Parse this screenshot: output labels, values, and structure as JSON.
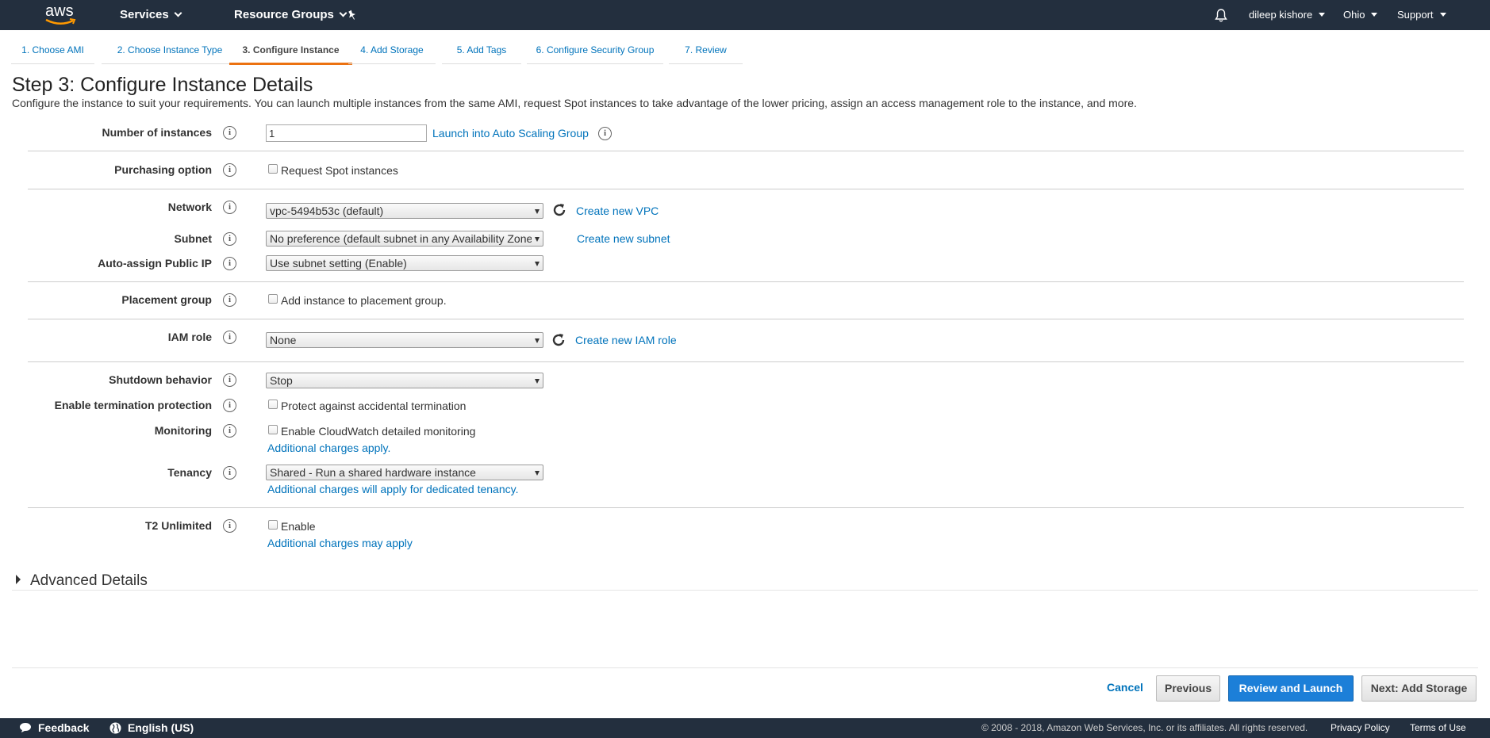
{
  "topnav": {
    "logo_text": "aws",
    "services": "Services",
    "resource_groups": "Resource Groups",
    "user": "dileep kishore",
    "region": "Ohio",
    "support": "Support"
  },
  "wizard_tabs": [
    "1. Choose AMI",
    "2. Choose Instance Type",
    "3. Configure Instance",
    "4. Add Storage",
    "5. Add Tags",
    "6. Configure Security Group",
    "7. Review"
  ],
  "active_tab_index": 2,
  "page": {
    "title": "Step 3: Configure Instance Details",
    "subtitle": "Configure the instance to suit your requirements. You can launch multiple instances from the same AMI, request Spot instances to take advantage of the lower pricing, assign an access management role to the instance, and more."
  },
  "form": {
    "instances": {
      "label": "Number of instances",
      "value": "1",
      "link": "Launch into Auto Scaling Group"
    },
    "purchasing": {
      "label": "Purchasing option",
      "checkbox": "Request Spot instances"
    },
    "network": {
      "label": "Network",
      "value": "vpc-5494b53c (default)",
      "link": "Create new VPC"
    },
    "subnet": {
      "label": "Subnet",
      "value": "No preference (default subnet in any Availability Zone)",
      "link": "Create new subnet"
    },
    "public_ip": {
      "label": "Auto-assign Public IP",
      "value": "Use subnet setting (Enable)"
    },
    "placement": {
      "label": "Placement group",
      "checkbox": "Add instance to placement group."
    },
    "iam": {
      "label": "IAM role",
      "value": "None",
      "link": "Create new IAM role"
    },
    "shutdown": {
      "label": "Shutdown behavior",
      "value": "Stop"
    },
    "termination": {
      "label": "Enable termination protection",
      "checkbox": "Protect against accidental termination"
    },
    "monitoring": {
      "label": "Monitoring",
      "checkbox": "Enable CloudWatch detailed monitoring",
      "link": "Additional charges apply."
    },
    "tenancy": {
      "label": "Tenancy",
      "value": "Shared - Run a shared hardware instance",
      "link": "Additional charges will apply for dedicated tenancy."
    },
    "t2": {
      "label": "T2 Unlimited",
      "checkbox": "Enable",
      "link": "Additional charges may apply"
    }
  },
  "advanced": "Advanced Details",
  "actions": {
    "cancel": "Cancel",
    "previous": "Previous",
    "review_launch": "Review and Launch",
    "next": "Next: Add Storage"
  },
  "footer": {
    "feedback": "Feedback",
    "language": "English (US)",
    "copyright": "© 2008 - 2018, Amazon Web Services, Inc. or its affiliates. All rights reserved.",
    "privacy": "Privacy Policy",
    "terms": "Terms of Use"
  },
  "colors": {
    "nav_bg": "#232f3e",
    "link": "#0073bb",
    "accent": "#ec7211",
    "primary_button": "#1c7fd8"
  }
}
